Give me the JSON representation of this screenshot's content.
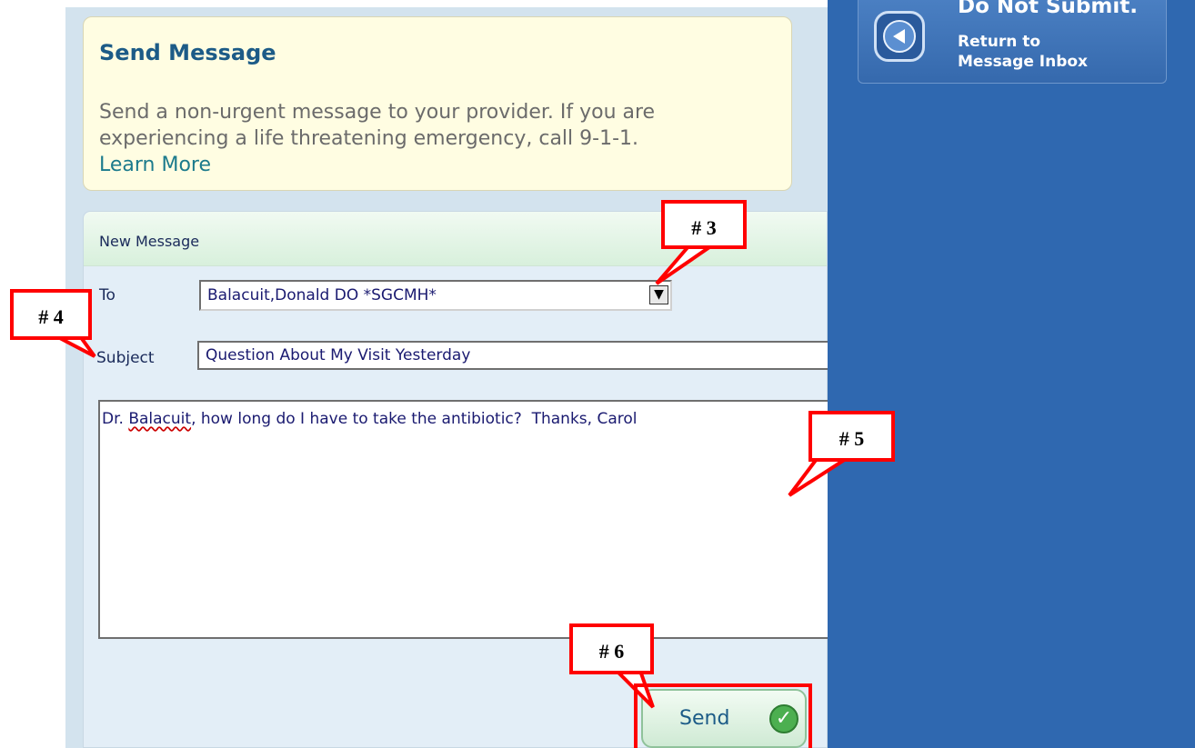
{
  "intro": {
    "title": "Send Message",
    "text": "Send a non-urgent message to your provider. If you are experiencing a life threatening emergency, call 9-1-1.",
    "learn_more": "Learn More"
  },
  "form": {
    "header": "New Message",
    "to_label": "To",
    "to_value": "Balacuit,Donald DO *SGCMH*",
    "subject_label": "Subject",
    "subject_value": "Question About My Visit Yesterday",
    "body_prefix": "Dr. ",
    "body_misspelled": "Balacuit",
    "body_suffix": ", how long do I have to take the antibiotic?  Thanks, Carol",
    "send_label": "Send"
  },
  "return": {
    "title": "Do Not Submit.",
    "line1": "Return to",
    "line2": "Message Inbox"
  },
  "callouts": {
    "c3": "# 3",
    "c4": "# 4",
    "c5": "# 5",
    "c6": "# 6"
  },
  "colors": {
    "accent": "#1c5b87",
    "right_pane": "#2f68b0",
    "callout": "#ff0000"
  }
}
